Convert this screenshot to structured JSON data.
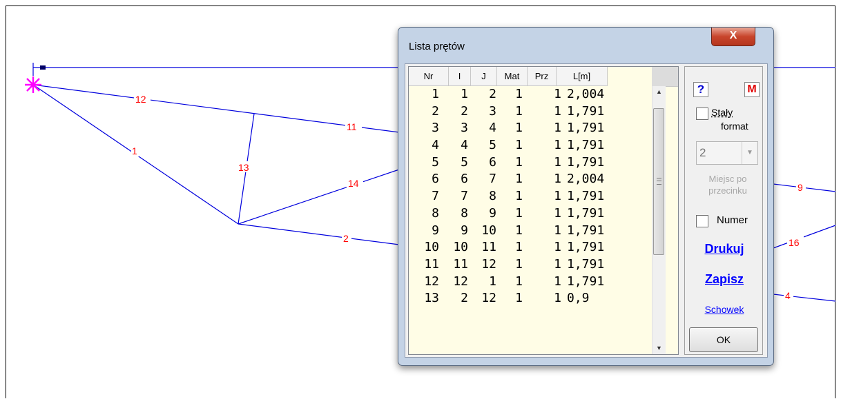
{
  "dialog": {
    "title": "Lista prętów",
    "close_glyph": "X"
  },
  "table": {
    "headers": [
      "Nr",
      "I",
      "J",
      "Mat",
      "Prz",
      "L[m]"
    ],
    "rows": [
      [
        "1",
        "1",
        "2",
        "1",
        "1",
        "2,004"
      ],
      [
        "2",
        "2",
        "3",
        "1",
        "1",
        "1,791"
      ],
      [
        "3",
        "3",
        "4",
        "1",
        "1",
        "1,791"
      ],
      [
        "4",
        "4",
        "5",
        "1",
        "1",
        "1,791"
      ],
      [
        "5",
        "5",
        "6",
        "1",
        "1",
        "1,791"
      ],
      [
        "6",
        "6",
        "7",
        "1",
        "1",
        "2,004"
      ],
      [
        "7",
        "7",
        "8",
        "1",
        "1",
        "1,791"
      ],
      [
        "8",
        "8",
        "9",
        "1",
        "1",
        "1,791"
      ],
      [
        "9",
        "9",
        "10",
        "1",
        "1",
        "1,791"
      ],
      [
        "10",
        "10",
        "11",
        "1",
        "1",
        "1,791"
      ],
      [
        "11",
        "11",
        "12",
        "1",
        "1",
        "1,791"
      ],
      [
        "12",
        "12",
        "1",
        "1",
        "1",
        "1,791"
      ],
      [
        "13",
        "2",
        "12",
        "1",
        "1",
        "0,9"
      ]
    ]
  },
  "side": {
    "help_label": "?",
    "m_label": "M",
    "fixed_label_line1": "Stały",
    "fixed_label_line2": "format",
    "decimal_value": "2",
    "decimal_label": "Miejsc po przecinku",
    "number_label": "Numer",
    "print_label": "Drukuj",
    "save_label": "Zapisz",
    "clipboard_label": "Schowek",
    "ok_label": "OK"
  },
  "truss": {
    "member_labels": [
      "12",
      "11",
      "1",
      "13",
      "14",
      "2",
      "9",
      "16",
      "4"
    ],
    "line_color": "#0000dd",
    "label_color": "#ff0000",
    "support_color": "#ff00ff"
  }
}
